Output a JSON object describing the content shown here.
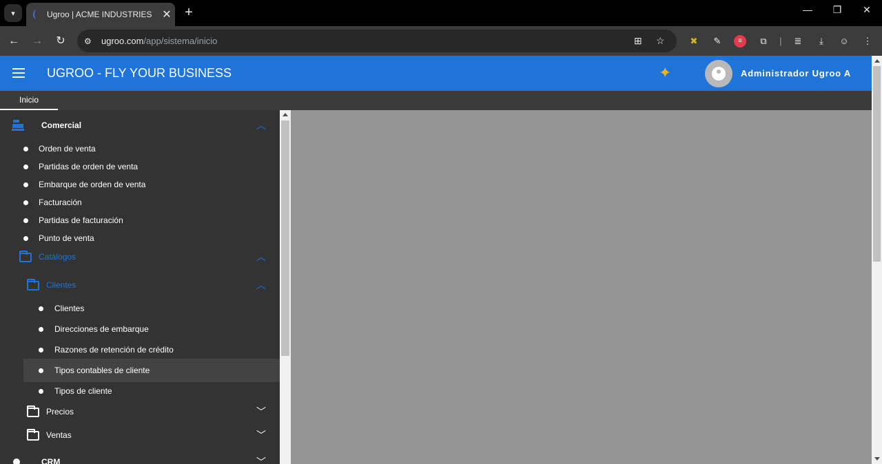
{
  "browser": {
    "tab_title": "Ugroo | ACME INDUSTRIES",
    "tab_close": "✕",
    "new_tab": "+",
    "url_host": "ugroo.com",
    "url_path": "/app/sistema/inicio",
    "window_controls": [
      "—",
      "❐",
      "✕"
    ],
    "nav": {
      "back": "←",
      "forward": "→",
      "reload": "↻"
    }
  },
  "header": {
    "title": "UGROO - FLY YOUR BUSINESS",
    "sparkle": "✦",
    "user_name": "Administrador Ugroo A",
    "accent_color": "#1e74d8"
  },
  "tabs": [
    {
      "label": "Inicio"
    }
  ],
  "sidebar": {
    "comercial": {
      "label": "Comercial",
      "items": [
        "Orden de venta",
        "Partidas de orden de venta",
        "Embarque de orden de venta",
        "Facturación",
        "Partidas de facturación",
        "Punto de venta"
      ],
      "catalogos": {
        "label": "Catálogos",
        "clientes": {
          "label": "Clientes",
          "items": [
            "Clientes",
            "Direcciones de embarque",
            "Razones de retención de crédito",
            "Tipos contables de cliente",
            "Tipos de cliente"
          ]
        },
        "precios": {
          "label": "Precios"
        },
        "ventas": {
          "label": "Ventas"
        }
      }
    },
    "crm": {
      "label": "CRM"
    }
  }
}
